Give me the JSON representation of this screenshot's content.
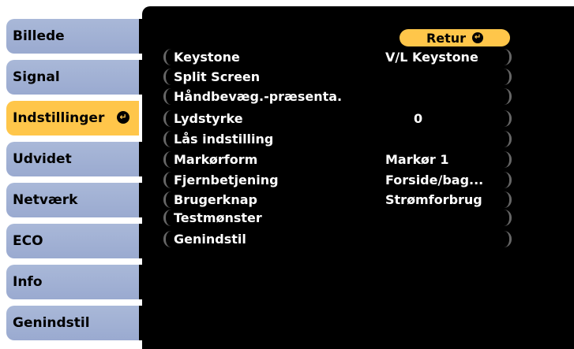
{
  "sidebar": {
    "items": [
      {
        "label": "Billede"
      },
      {
        "label": "Signal"
      },
      {
        "label": "Indstillinger"
      },
      {
        "label": "Udvidet"
      },
      {
        "label": "Netværk"
      },
      {
        "label": "ECO"
      },
      {
        "label": "Info"
      },
      {
        "label": "Genindstil"
      }
    ],
    "active_index": 2
  },
  "main": {
    "return_label": "Retur",
    "rows": [
      {
        "label": "Keystone",
        "value": "V/L Keystone"
      },
      {
        "label": "Split Screen",
        "value": ""
      },
      {
        "label": "Håndbevæg.-præsenta.",
        "value": ""
      },
      {
        "label": "Lydstyrke",
        "value": "0"
      },
      {
        "label": "Lås indstilling",
        "value": ""
      },
      {
        "label": "Markørform",
        "value": "Markør 1"
      },
      {
        "label": "Fjernbetjening",
        "value": "Forside/bag..."
      },
      {
        "label": "Brugerknap",
        "value": "Strømforbrug"
      },
      {
        "label": "Testmønster",
        "value": ""
      },
      {
        "label": "Genindstil",
        "value": ""
      }
    ]
  },
  "icons": {
    "enter": "enter-icon"
  },
  "colors": {
    "tab": "#9aaad0",
    "active_tab": "#ffc64a",
    "panel": "#000000",
    "text": "#ffffff"
  }
}
